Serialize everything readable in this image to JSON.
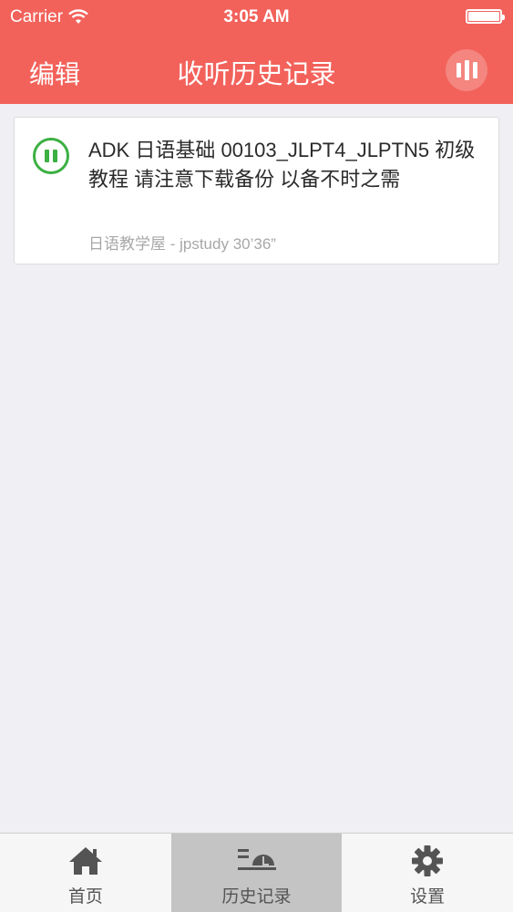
{
  "status_bar": {
    "carrier": "Carrier",
    "time": "3:05 AM"
  },
  "nav": {
    "left_button": "编辑",
    "title": "收听历史记录",
    "right_icon": "equalizer-icon"
  },
  "history": [
    {
      "title": "ADK 日语基础 00103_JLPT4_JLPTN5 初级教程 请注意下载备份 以备不时之需",
      "meta": "日语教学屋 - jpstudy  30’36”",
      "state": "playing",
      "accent": "#3cb043"
    }
  ],
  "tabbar": {
    "items": [
      {
        "label": "首页",
        "icon": "home-icon",
        "active": false
      },
      {
        "label": "历史记录",
        "icon": "history-icon",
        "active": true
      },
      {
        "label": "设置",
        "icon": "gear-icon",
        "active": false
      }
    ]
  },
  "colors": {
    "header": "#f2625b",
    "background": "#efeff4",
    "active_tab": "#c4c4c4"
  }
}
